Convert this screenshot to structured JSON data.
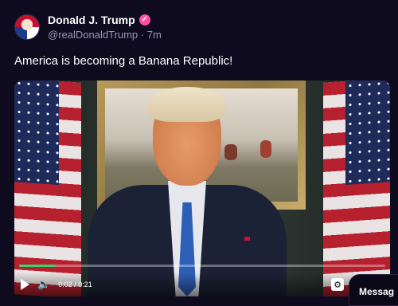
{
  "post": {
    "author_name": "Donald J. Trump",
    "handle": "@realDonaldTrump",
    "separator": "·",
    "time_ago": "7m",
    "text": "America is becoming a Banana Republic!"
  },
  "video": {
    "current_time": "0:02",
    "duration": "0:21",
    "time_display": "0:02 / 0:21",
    "progress_fraction": 0.1
  },
  "icons": {
    "avatar": "avatar",
    "verified": "verified-badge-icon",
    "play": "play-icon",
    "volume": "volume-icon",
    "settings": "gear-icon",
    "fullscreen": "fullscreen-icon",
    "rumble": "rumble-logo-icon"
  },
  "colors": {
    "background": "#0f0b1e",
    "verified_badge": "#ff4fa0",
    "progress": "#3cd26a",
    "handle_text": "#9a95b3"
  },
  "message_button": {
    "label": "Messag"
  }
}
